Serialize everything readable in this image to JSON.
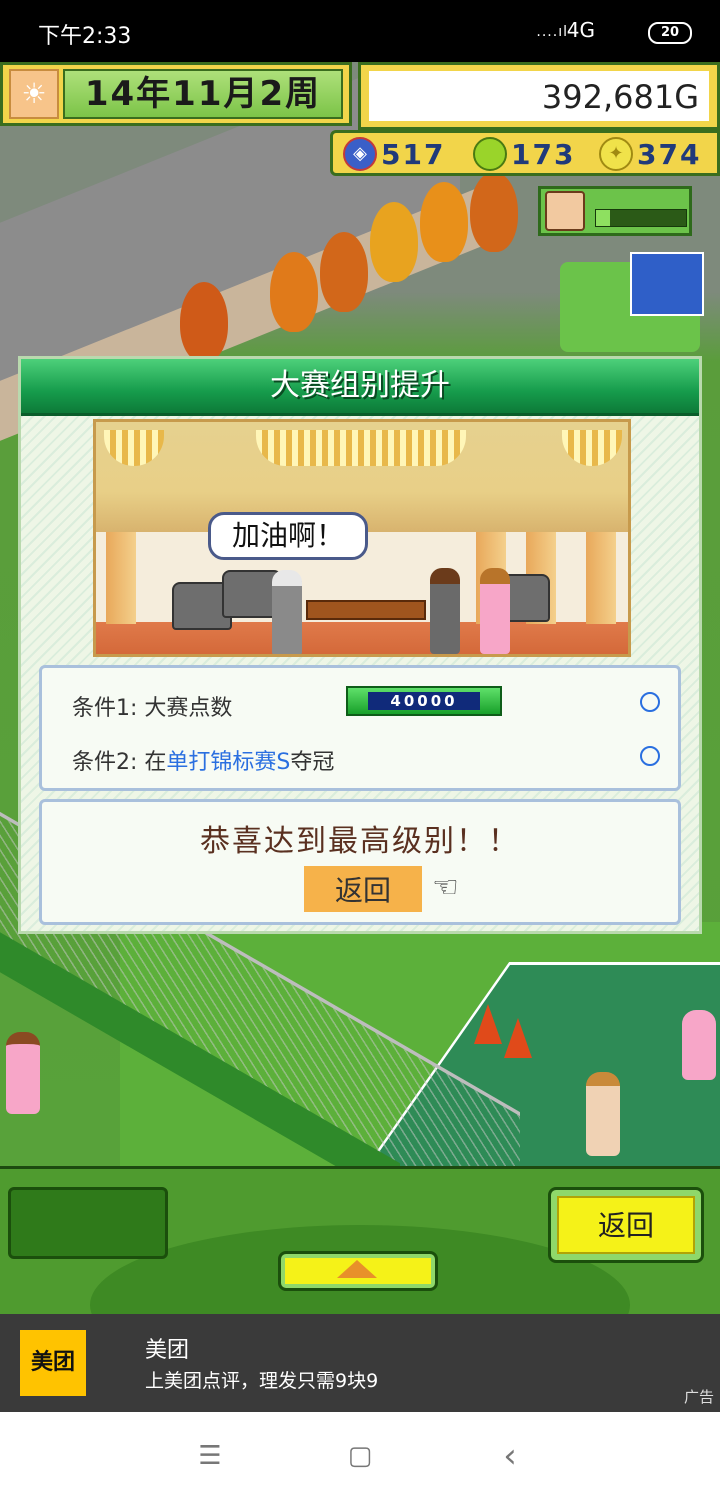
{
  "status_bar": {
    "time": "下午2:33",
    "signal": "....ıl",
    "network": "4G",
    "battery": "20"
  },
  "hud": {
    "date": "14年11月2周",
    "money": "392,681G",
    "stats": [
      {
        "icon": "medal-icon",
        "value": "517"
      },
      {
        "icon": "tennis-ball-icon",
        "value": "173"
      },
      {
        "icon": "lightbulb-icon",
        "value": "374"
      }
    ]
  },
  "dialog": {
    "title": "大赛组别提升",
    "speech": "加油啊！",
    "conditions": [
      {
        "prefix": "条件1: 大赛点数",
        "points": "40000"
      },
      {
        "prefix": "条件2: 在",
        "highlight": "单打锦标赛S",
        "suffix": "夺冠"
      }
    ],
    "congrats": "恭喜达到最高级别！！",
    "back_label": "返回"
  },
  "bottom_hud": {
    "back_label": "返回"
  },
  "ad": {
    "logo": "美团",
    "title": "美团",
    "subtitle": "上美团点评，理发只需9块9",
    "tag": "广告"
  },
  "nav": {
    "menu_icon": "☰",
    "home_icon": "▢",
    "back_icon": "‹"
  }
}
